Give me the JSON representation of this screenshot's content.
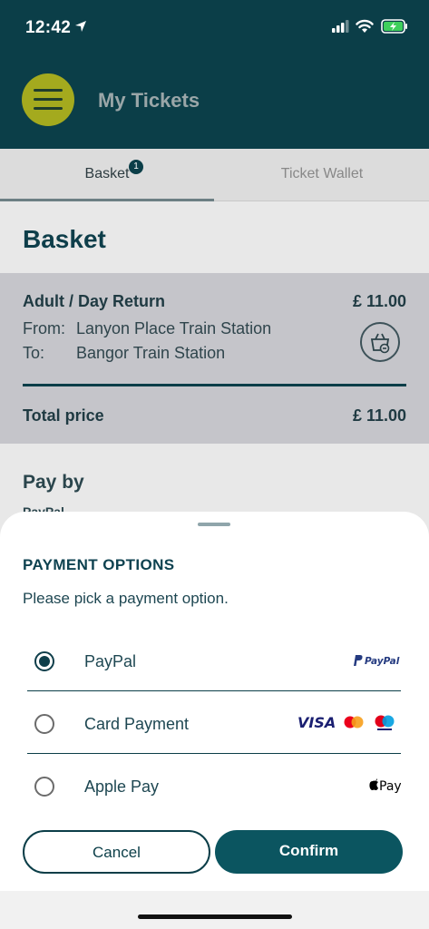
{
  "status_bar": {
    "time": "12:42"
  },
  "header": {
    "title": "My Tickets",
    "menu_icon": "hamburger-icon"
  },
  "tabs": [
    {
      "label": "Basket",
      "badge": "1",
      "active": true
    },
    {
      "label": "Ticket Wallet",
      "active": false
    }
  ],
  "basket": {
    "title": "Basket",
    "ticket": {
      "type": "Adult / Day Return",
      "price": "£ 11.00",
      "from_label": "From:",
      "from_value": "Lanyon Place Train Station",
      "to_label": "To:",
      "to_value": "Bangor Train Station"
    },
    "total_label": "Total price",
    "total_value": "£ 11.00",
    "pay_by_title": "Pay by",
    "pay_by_current": "PayPal"
  },
  "sheet": {
    "title": "PAYMENT OPTIONS",
    "subtitle": "Please pick a payment option.",
    "options": [
      {
        "label": "PayPal",
        "selected": true,
        "logo_text": "PayPal"
      },
      {
        "label": "Card Payment",
        "selected": false,
        "logo_text": "VISA"
      },
      {
        "label": "Apple Pay",
        "selected": false,
        "logo_text": "Pay"
      }
    ],
    "cancel_label": "Cancel",
    "confirm_label": "Confirm"
  },
  "colors": {
    "primary": "#0b3e48",
    "accent": "#a4aa1e",
    "confirm": "#0b5560"
  }
}
